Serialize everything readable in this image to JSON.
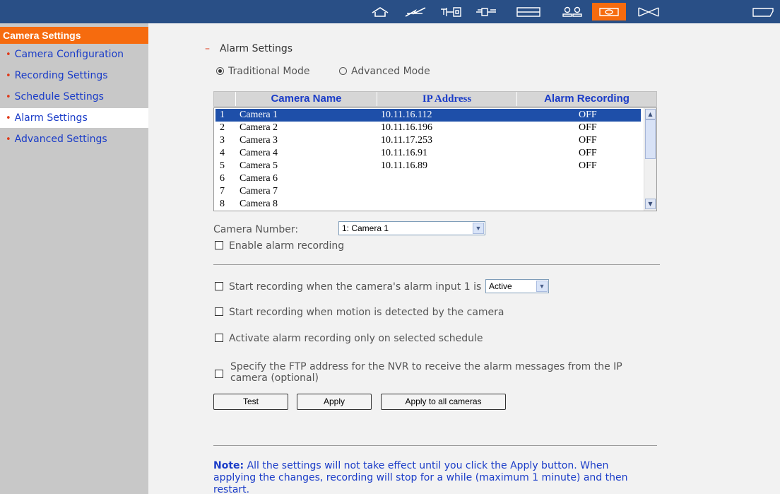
{
  "topbar": {
    "icons": [
      "home-icon",
      "flash-icon",
      "connector-icon",
      "plug-icon",
      "list-icon",
      "users-icon",
      "camera-icon",
      "envelope-icon",
      "folder-icon"
    ],
    "active_icon": "camera-icon",
    "colors": {
      "background": "#294f86",
      "active": "#f66b0e"
    }
  },
  "sidebar": {
    "title": "Camera Settings",
    "items": [
      {
        "label": "Camera Configuration"
      },
      {
        "label": "Recording Settings"
      },
      {
        "label": "Schedule Settings"
      },
      {
        "label": "Alarm Settings"
      },
      {
        "label": "Advanced Settings"
      }
    ],
    "selected": "Alarm Settings"
  },
  "main": {
    "section_title": "Alarm Settings",
    "mode": {
      "traditional": "Traditional Mode",
      "advanced": "Advanced Mode",
      "selected": "Traditional Mode"
    },
    "table": {
      "headers": [
        "Camera Name",
        "IP Address",
        "Alarm Recording"
      ],
      "rows": [
        {
          "num": "1",
          "name": "Camera 1",
          "ip": "10.11.16.112",
          "alarm": "OFF"
        },
        {
          "num": "2",
          "name": "Camera 2",
          "ip": "10.11.16.196",
          "alarm": "OFF"
        },
        {
          "num": "3",
          "name": "Camera 3",
          "ip": "10.11.17.253",
          "alarm": "OFF"
        },
        {
          "num": "4",
          "name": "Camera 4",
          "ip": "10.11.16.91",
          "alarm": "OFF"
        },
        {
          "num": "5",
          "name": "Camera 5",
          "ip": "10.11.16.89",
          "alarm": "OFF"
        },
        {
          "num": "6",
          "name": "Camera 6",
          "ip": "",
          "alarm": ""
        },
        {
          "num": "7",
          "name": "Camera 7",
          "ip": "",
          "alarm": ""
        },
        {
          "num": "8",
          "name": "Camera 8",
          "ip": "",
          "alarm": ""
        }
      ],
      "selected_row": "1"
    },
    "camera_number": {
      "label": "Camera Number:",
      "value": "1: Camera 1"
    },
    "enable_alarm": "Enable alarm recording",
    "options": {
      "alarm_input_prefix": "Start recording when the camera's alarm input 1 is",
      "alarm_input_value": "Active",
      "motion": "Start recording when motion is detected by the camera",
      "schedule": "Activate alarm recording only on selected schedule",
      "ftp_line1": "Specify the FTP address for the NVR to receive the alarm messages from the IP",
      "ftp_line2": "camera (optional)"
    },
    "buttons": {
      "test": "Test",
      "apply": "Apply",
      "apply_all": "Apply to all cameras"
    },
    "note": {
      "label": "Note:",
      "line1": "All the settings will not take effect until you click the Apply button. When",
      "line2": "applying the changes, recording will stop for a while (maximum 1 minute) and then",
      "line3": "restart."
    }
  }
}
